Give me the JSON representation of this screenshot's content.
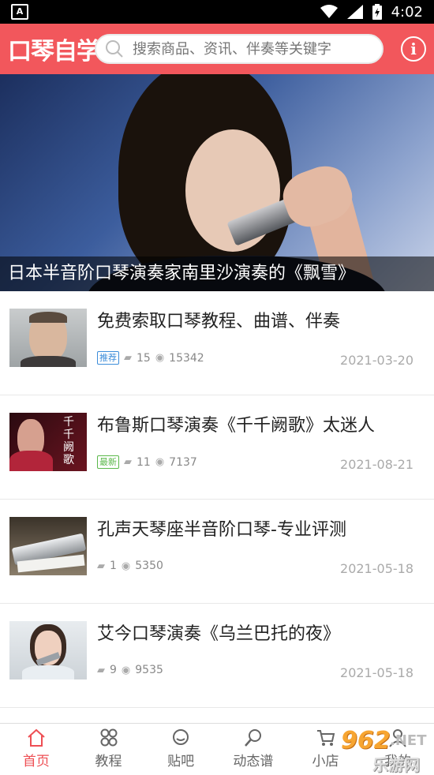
{
  "status": {
    "time": "4:02",
    "app_badge": "A"
  },
  "header": {
    "logo": "口琴自学",
    "search_placeholder": "搜索商品、资讯、伴奏等关键字"
  },
  "banner": {
    "caption": "日本半音阶口琴演奏家南里沙演奏的《飘雪》"
  },
  "articles": [
    {
      "title": "免费索取口琴教程、曲谱、伴奏",
      "tag": "推荐",
      "comments": "15",
      "views": "15342",
      "date": "2021-03-20"
    },
    {
      "title": "布鲁斯口琴演奏《千千阙歌》太迷人",
      "tag": "最新",
      "comments": "11",
      "views": "7137",
      "date": "2021-08-21",
      "thumb_text": "千千阙歌"
    },
    {
      "title": "孔声天琴座半音阶口琴-专业评测",
      "tag": "",
      "comments": "1",
      "views": "5350",
      "date": "2021-05-18"
    },
    {
      "title": "艾今口琴演奏《乌兰巴托的夜》",
      "tag": "",
      "comments": "9",
      "views": "9535",
      "date": "2021-05-18"
    }
  ],
  "nav": [
    {
      "label": "首页",
      "icon": "home-icon"
    },
    {
      "label": "教程",
      "icon": "grid-icon"
    },
    {
      "label": "贴吧",
      "icon": "chat-icon"
    },
    {
      "label": "动态谱",
      "icon": "search-icon"
    },
    {
      "label": "小店",
      "icon": "cart-icon"
    },
    {
      "label": "我的",
      "icon": "user-icon"
    }
  ],
  "watermark": {
    "number": "962",
    "suffix": ".NET",
    "text": "乐游网"
  },
  "colors": {
    "brand": "#f2575c",
    "active_nav": "#ee4f54"
  }
}
